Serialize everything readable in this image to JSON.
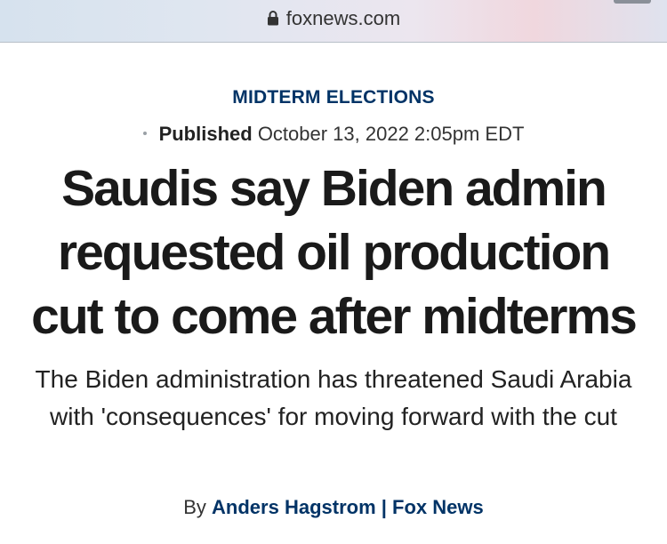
{
  "browser": {
    "url": "foxnews.com",
    "lock_icon": "lock-icon"
  },
  "article": {
    "category": "MIDTERM ELECTIONS",
    "published_label": "Published",
    "published_date": "October 13, 2022 2:05pm EDT",
    "headline": "Saudis say Biden admin requested oil production cut to come after midterms",
    "subheadline": "The Biden administration has threatened Saudi Arabia with 'consequences' for moving forward with the cut",
    "byline": {
      "prefix": "By",
      "author": "Anders Hagstrom",
      "separator": "|",
      "outlet": "Fox News"
    }
  },
  "colors": {
    "accent": "#003366",
    "headline": "#1a1a1a"
  }
}
